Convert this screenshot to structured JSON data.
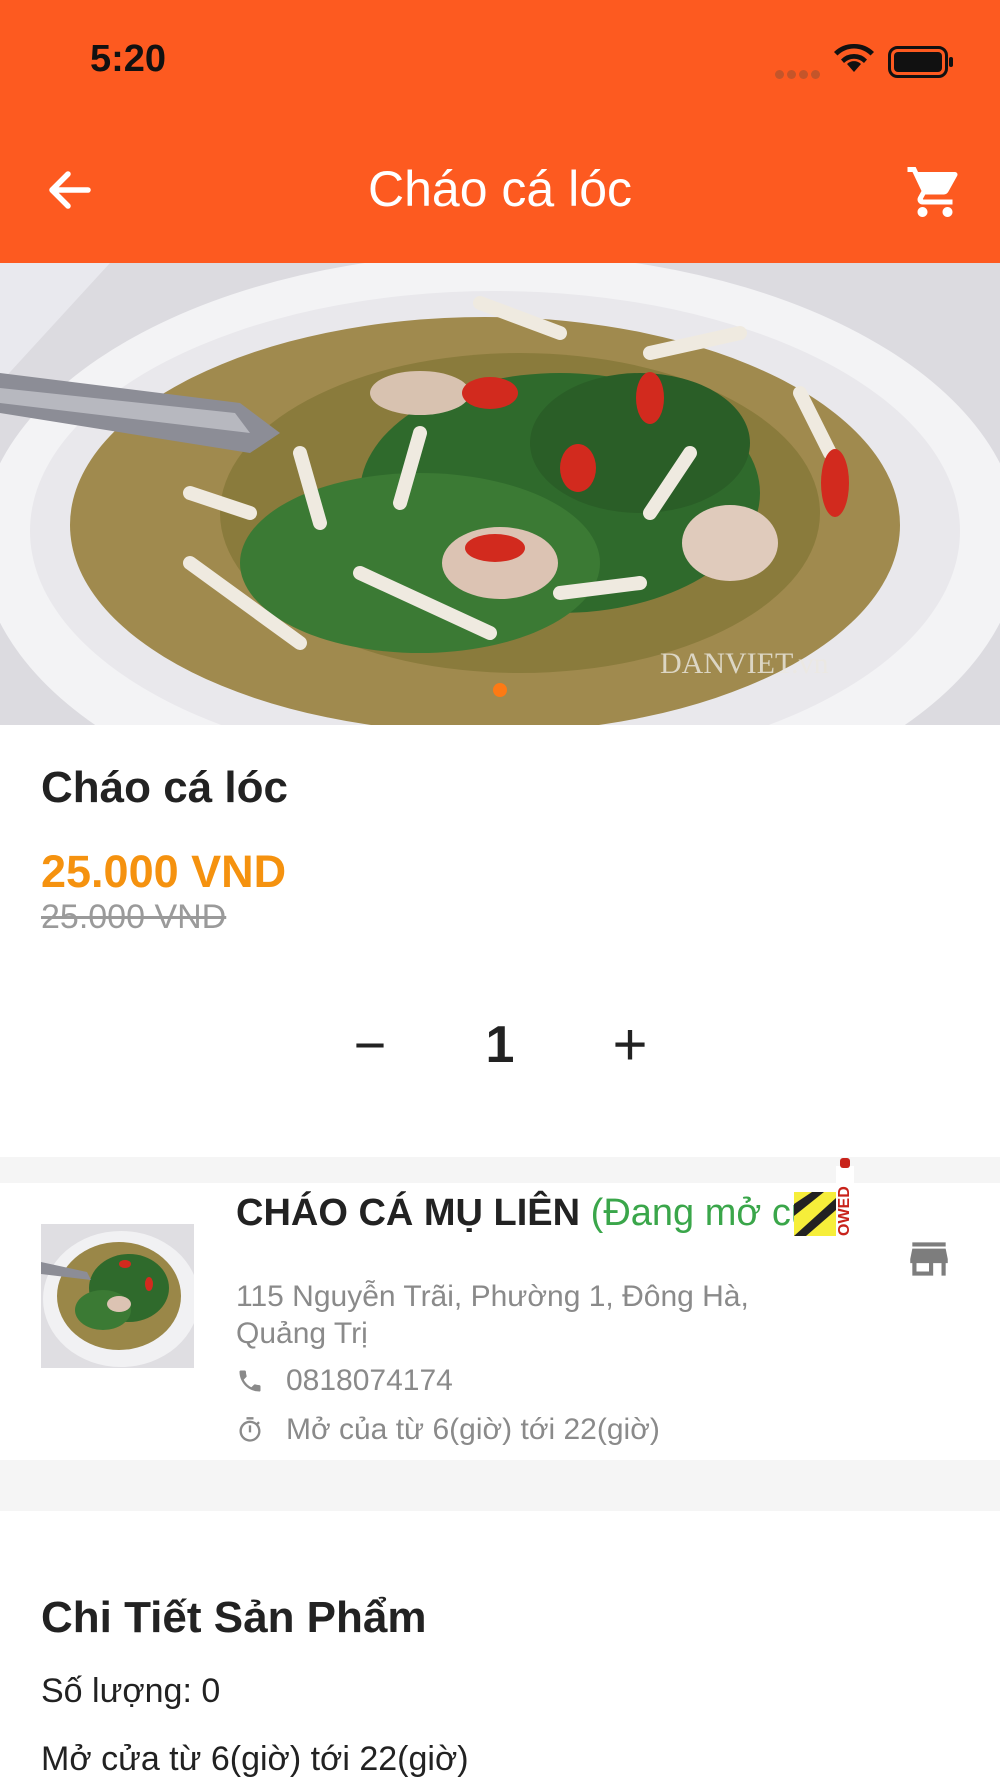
{
  "status_bar": {
    "time": "5:20"
  },
  "app_bar": {
    "title": "Cháo cá lóc",
    "back_icon": "arrow-left-icon",
    "cart_icon": "shopping-cart-icon",
    "background": "#FD5A20"
  },
  "carousel": {
    "image": "bowl-of-fish-porridge-photo",
    "watermark": "DANVIET.vn",
    "active_dot_color": "#FD7A14"
  },
  "product": {
    "name": "Cháo cá lóc",
    "price": "25.000 VND",
    "old_price": "25.000 VND",
    "price_color": "#F5920F"
  },
  "quantity": {
    "minus": "−",
    "value": "1",
    "plus": "+"
  },
  "store": {
    "name": "CHÁO CÁ MỤ LIÊN",
    "status": "(Đang mở cửa)",
    "status_color": "#3aa64a",
    "address": "115 Nguyễn Trãi, Phường 1, Đông Hà, Quảng Trị",
    "phone": "0818074174",
    "hours": "Mở của từ 6(giờ) tới 22(giờ)",
    "icons": [
      "phone-icon",
      "timer-icon",
      "store-icon"
    ],
    "sticker_text": "OWED"
  },
  "details": {
    "title": "Chi Tiết Sản Phẩm",
    "quantity_line": "Số lượng: 0",
    "hours_line": "Mở cửa từ 6(giờ) tới 22(giờ)"
  }
}
